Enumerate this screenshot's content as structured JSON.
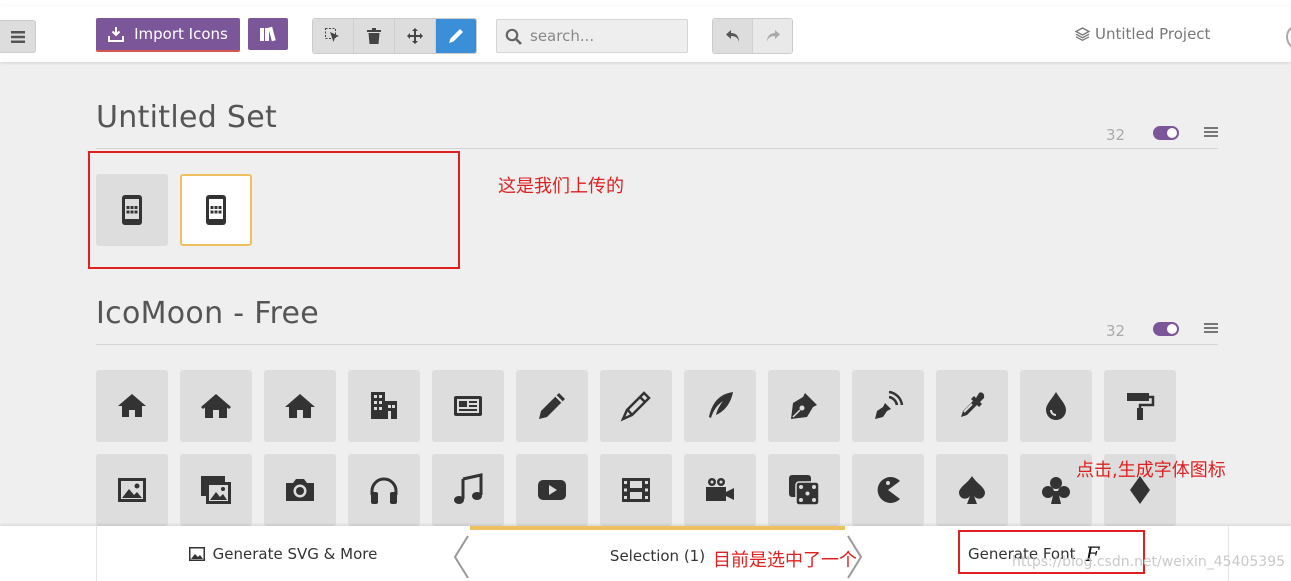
{
  "toolbar": {
    "import_label": "Import Icons",
    "search_placeholder": "search...",
    "project_name": "Untitled Project"
  },
  "sets": [
    {
      "title": "Untitled Set",
      "count": "32"
    },
    {
      "title": "IcoMoon - Free",
      "count": "32"
    }
  ],
  "annotations": {
    "uploaded": "这是我们上传的",
    "generate_hint": "点击,生成字体图标",
    "selected_hint": "目前是选中了一个"
  },
  "bottom": {
    "generate_svg": "Generate SVG & More",
    "selection": "Selection (1)",
    "generate_font": "Generate Font",
    "font_icon_glyph": "F"
  },
  "watermark": "https://blog.csdn.net/weixin_45405395",
  "colors": {
    "accent_purple": "#7b579a",
    "active_blue": "#3a8fd8",
    "selected_border": "#f0c060",
    "annotation_red": "#e02020"
  },
  "icons": {
    "untitled_set": [
      "tablet-icon",
      "tablet-icon"
    ],
    "icomoon_row1": [
      "home-icon",
      "home2-icon",
      "home3-icon",
      "office-icon",
      "newspaper-icon",
      "pencil-icon",
      "pencil2-icon",
      "quill-icon",
      "pen-icon",
      "blog-icon",
      "eyedropper-icon",
      "droplet-icon",
      "paint-format-icon"
    ],
    "icomoon_row2": [
      "image-icon",
      "images-icon",
      "camera-icon",
      "headphones-icon",
      "music-icon",
      "play-icon",
      "film-icon",
      "video-camera-icon",
      "dice-icon",
      "pacman-icon",
      "spades-icon",
      "clubs-icon",
      "diamonds-icon"
    ]
  }
}
